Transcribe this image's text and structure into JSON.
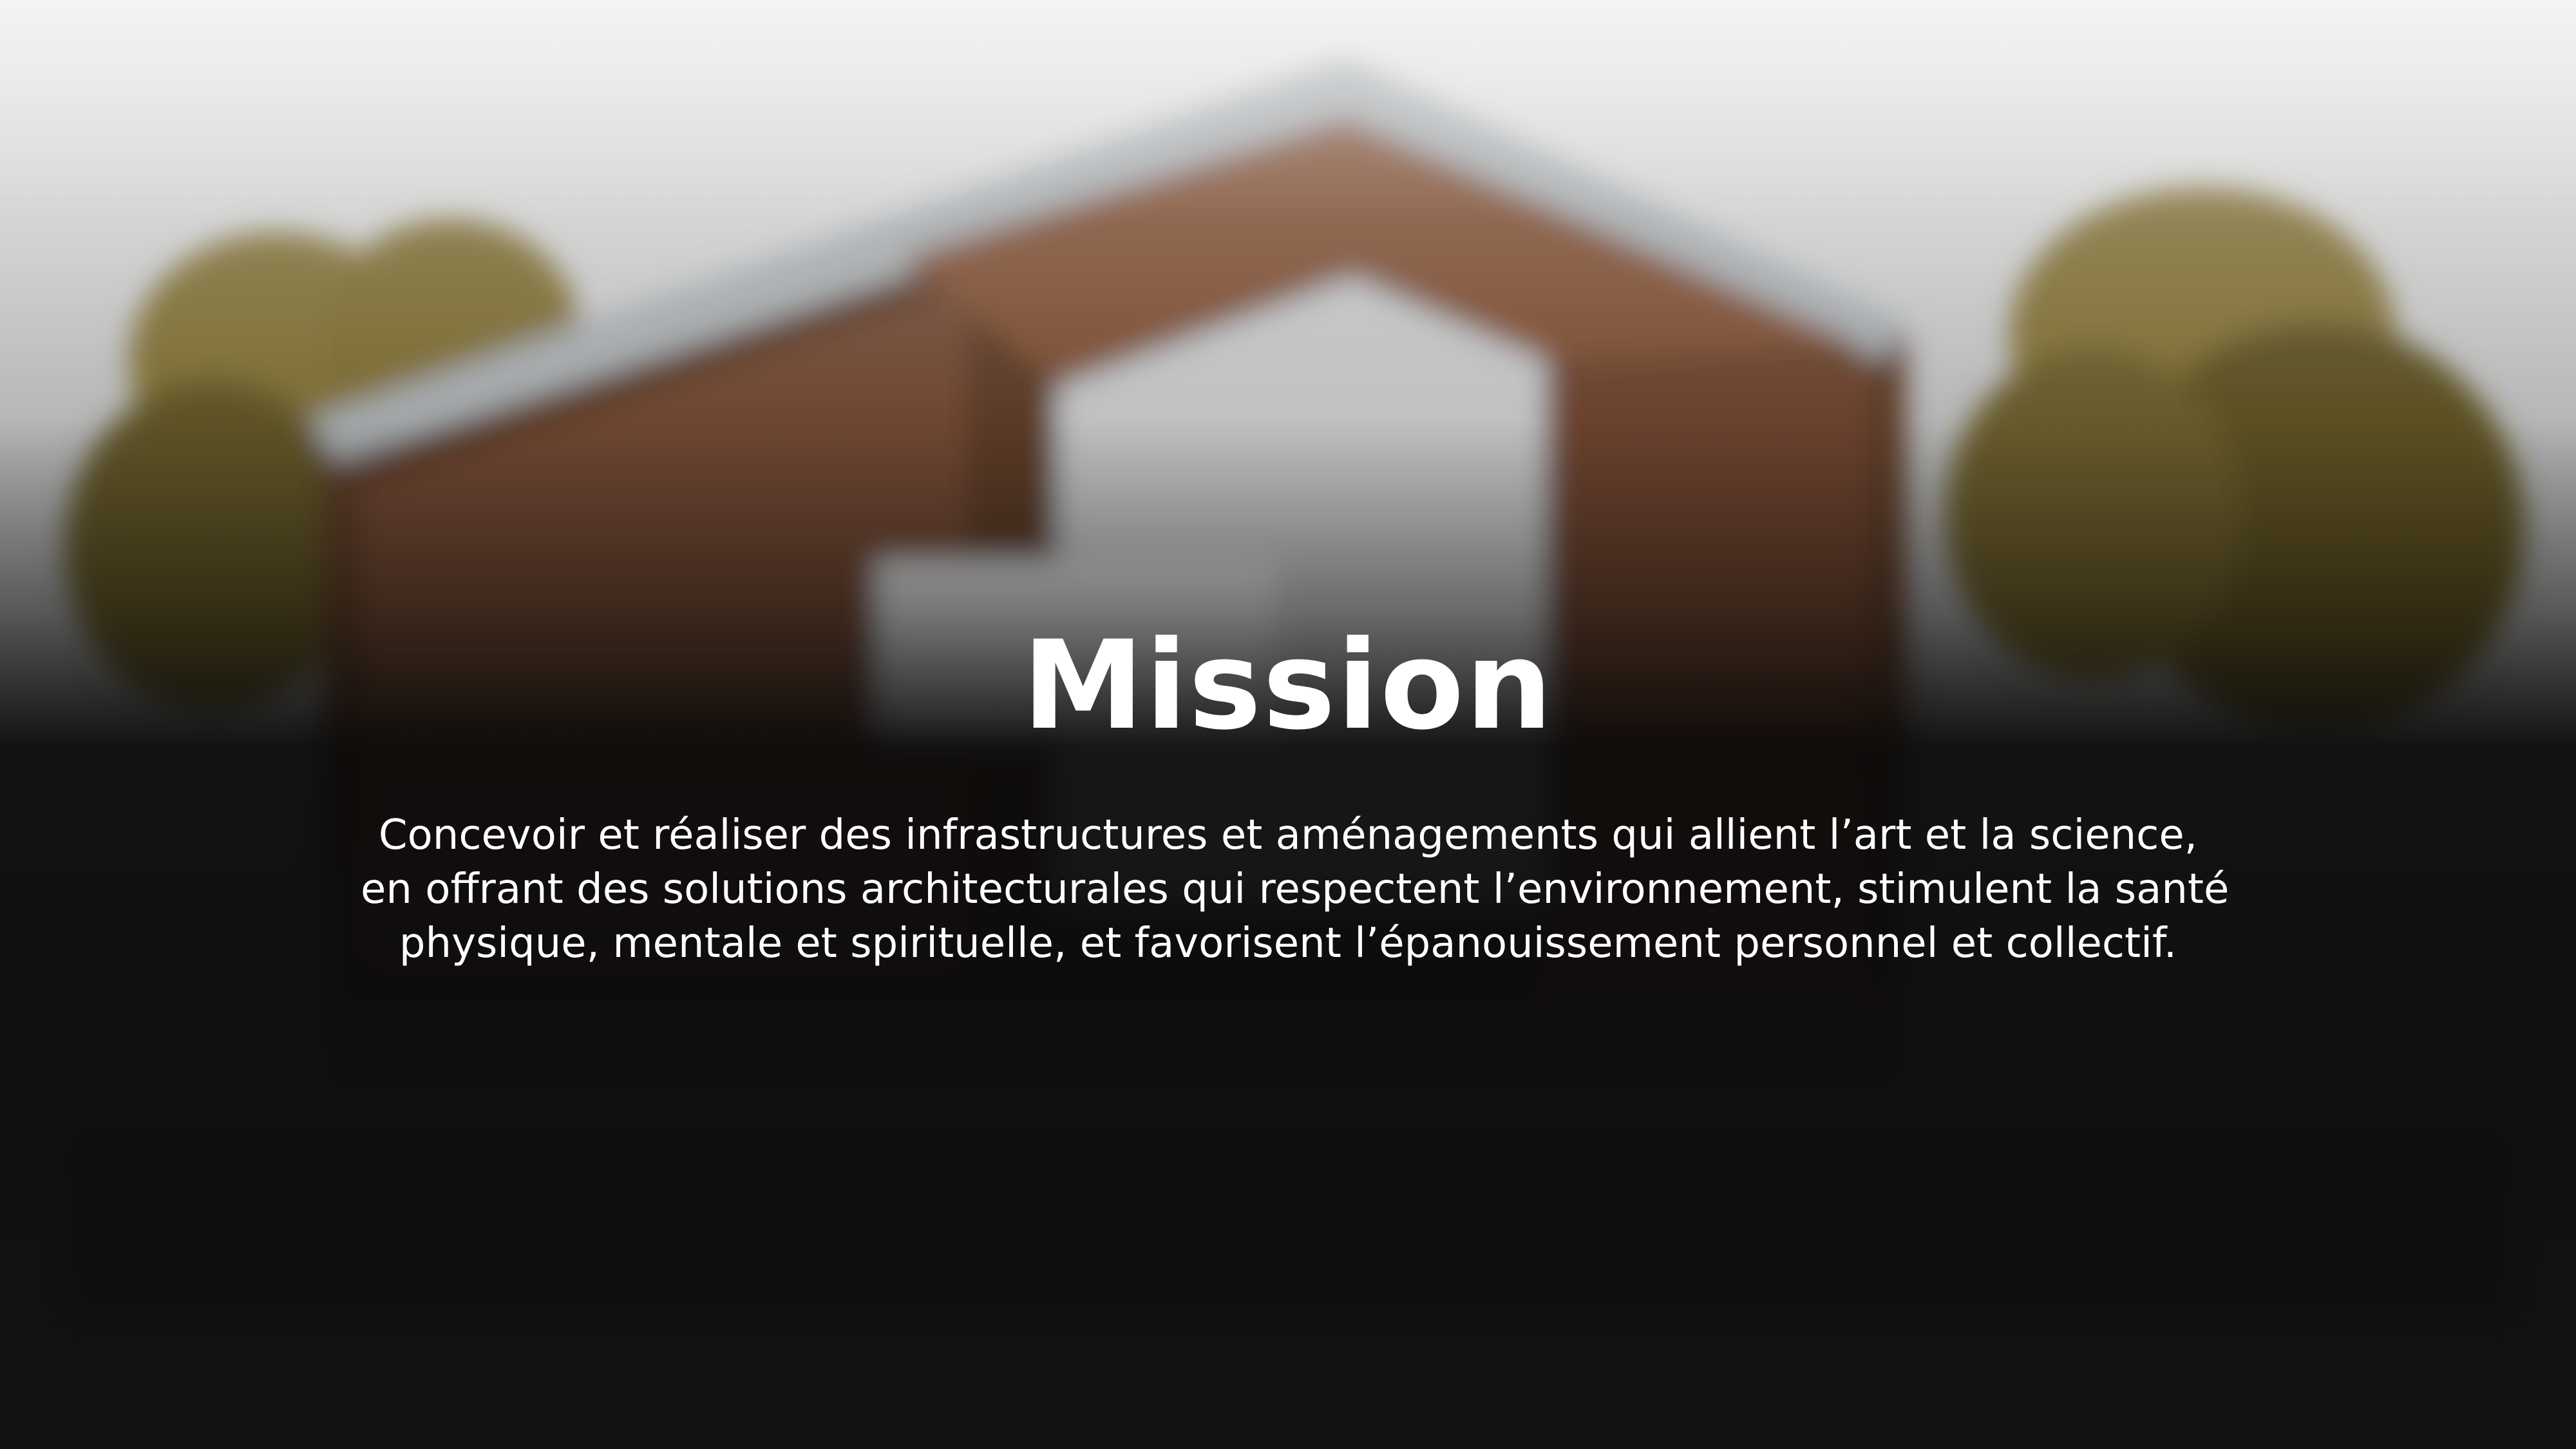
{
  "slide": {
    "title": "Mission",
    "paragraph_lines": [
      "Concevoir et réaliser des infrastructures et aménagements qui allient l’art et la science,",
      "en offrant des solutions architecturales qui respectent l’environnement, stimulent la santé",
      "physique, mentale et spirituelle, et favorisent l’épanouissement personnel et collectif."
    ]
  },
  "background": {
    "description_icon": "blurred-modern-house-photo",
    "colors": {
      "wood": "#7a4e33",
      "roof": "#9ea3a6",
      "foliage": "#8a7a3a",
      "sky": "#d9dadb",
      "overlay": "#0e0e0e"
    }
  }
}
